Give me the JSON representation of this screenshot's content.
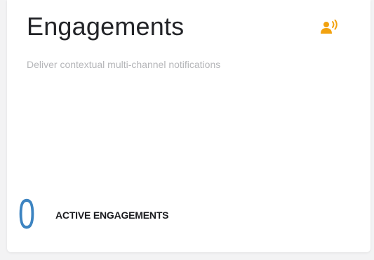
{
  "card": {
    "title": "Engagements",
    "subtitle": "Deliver contextual multi-channel notifications",
    "icon": "engagement-broadcast-icon",
    "accent_color": "#f2a20f",
    "metric": {
      "value": "0",
      "label": "ACTIVE ENGAGEMENTS",
      "value_color": "#3d84c1"
    }
  }
}
